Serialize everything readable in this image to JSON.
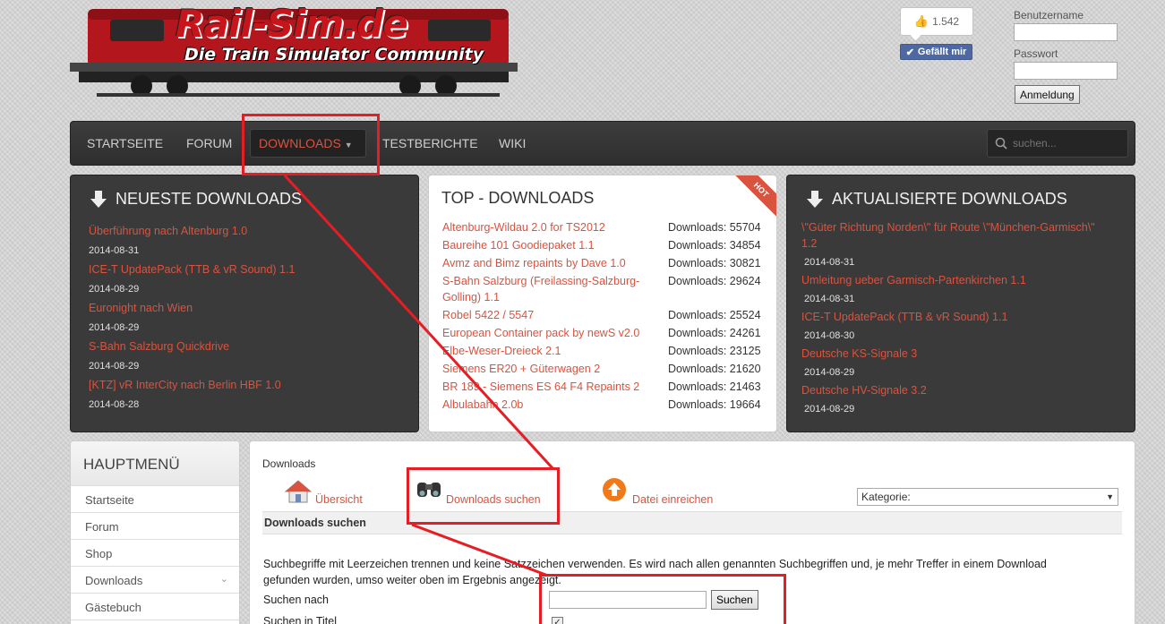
{
  "logo": {
    "title": "Rail-Sim.de",
    "subtitle": "Die Train Simulator Community"
  },
  "facebook": {
    "like_count": "1.542",
    "like_label": "Gefällt mir"
  },
  "login": {
    "username_label": "Benutzername",
    "password_label": "Passwort",
    "button_label": "Anmeldung"
  },
  "nav": {
    "items": [
      "STARTSEITE",
      "FORUM",
      "DOWNLOADS",
      "TESTBERICHTE",
      "WIKI"
    ],
    "search_placeholder": "suchen..."
  },
  "newest": {
    "title": "NEUESTE DOWNLOADS",
    "items": [
      {
        "name": "Überführung nach Altenburg 1.0",
        "date": "2014-08-31"
      },
      {
        "name": "ICE-T UpdatePack (TTB & vR Sound) 1.1",
        "date": "2014-08-29"
      },
      {
        "name": "Euronight nach Wien",
        "date": "2014-08-29"
      },
      {
        "name": "S-Bahn Salzburg Quickdrive",
        "date": "2014-08-29"
      },
      {
        "name": "[KTZ] vR InterCity nach Berlin HBF 1.0",
        "date": "2014-08-28"
      }
    ]
  },
  "top": {
    "title": "TOP - DOWNLOADS",
    "badge": "HOT",
    "items": [
      {
        "name": "Altenburg-Wildau 2.0 for TS2012",
        "count": "Downloads: 55704"
      },
      {
        "name": "Baureihe 101 Goodiepaket 1.1",
        "count": "Downloads: 34854"
      },
      {
        "name": "Avmz and Bimz repaints by Dave 1.0",
        "count": "Downloads: 30821"
      },
      {
        "name": "S-Bahn Salzburg (Freilassing-Salzburg-",
        "name2": "Golling) 1.1",
        "count": "Downloads: 29624"
      },
      {
        "name": "Robel 5422 / 5547",
        "count": "Downloads: 25524"
      },
      {
        "name": "European Container pack by newS v2.0",
        "count": "Downloads: 24261"
      },
      {
        "name": "Elbe-Weser-Dreieck 2.1",
        "count": "Downloads: 23125"
      },
      {
        "name": "Siemens ER20 + Güterwagen 2",
        "count": "Downloads: 21620"
      },
      {
        "name": "BR 189 - Siemens ES 64 F4 Repaints 2",
        "count": "Downloads: 21463"
      },
      {
        "name": "Albulabahn 2.0b",
        "count": "Downloads: 19664"
      }
    ]
  },
  "updated": {
    "title": "AKTUALISIERTE DOWNLOADS",
    "items": [
      {
        "name": "\\\"Güter Richtung Norden\\\" für Route \\\"München-Garmisch\\\"",
        "name2": "1.2",
        "date": "2014-08-31"
      },
      {
        "name": "Umleitung ueber Garmisch-Partenkirchen 1.1",
        "date": "2014-08-31"
      },
      {
        "name": "ICE-T UpdatePack (TTB & vR Sound) 1.1",
        "date": "2014-08-30"
      },
      {
        "name": "Deutsche KS-Signale 3",
        "date": "2014-08-29"
      },
      {
        "name": "Deutsche HV-Signale 3.2",
        "date": "2014-08-29"
      }
    ]
  },
  "mainmenu": {
    "title": "HAUPTMENÜ",
    "items": [
      "Startseite",
      "Forum",
      "Shop",
      "Downloads",
      "Gästebuch"
    ]
  },
  "content": {
    "breadcrumb": "Downloads",
    "tabs": [
      "Übersicht",
      "Downloads suchen",
      "Datei einreichen"
    ],
    "category_label": "Kategorie:",
    "section_title": "Downloads suchen",
    "help_text": "Suchbegriffe mit Leerzeichen trennen und keine Satzzeichen verwenden. Es wird nach allen genannten Suchbegriffen und, je mehr Treffer in einem Download gefunden wurden, umso weiter oben im Ergebnis angezeigt.",
    "search_label": "Suchen nach",
    "search_button": "Suchen",
    "title_label": "Suchen in Titel"
  },
  "colors": {
    "accent": "#d9533f",
    "annotation": "#e51d24",
    "nav_bg": "#333333"
  }
}
